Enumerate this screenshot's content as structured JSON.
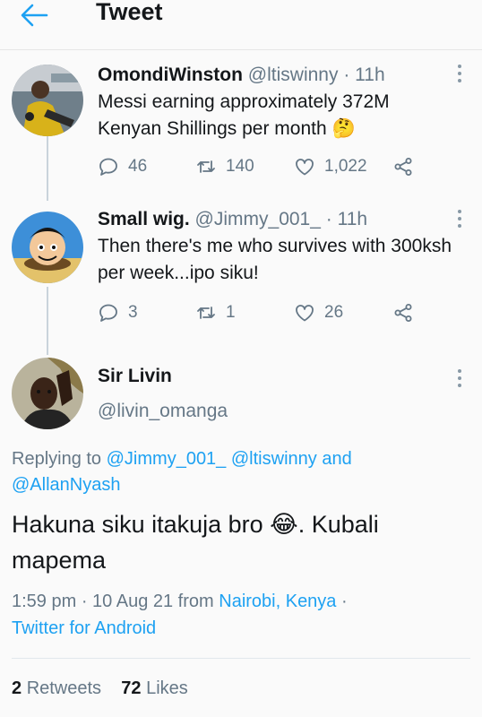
{
  "header": {
    "title": "Tweet",
    "back_icon": "arrow-left-icon"
  },
  "colors": {
    "accent": "#1da1f2",
    "muted": "#657786",
    "text": "#14171a"
  },
  "thread": [
    {
      "name": "OmondiWinston",
      "handle": "@ltiswinny",
      "time": "· 11h",
      "text": "Messi earning approximately 372M Kenyan Shillings per month",
      "emoji": "🤔",
      "replies": "46",
      "retweets": "140",
      "likes": "1,022"
    },
    {
      "name": "Small wig.",
      "handle": "@Jimmy_001_",
      "time": "· 11h",
      "text": "Then there's me who survives with 300ksh per week...ipo siku!",
      "replies": "3",
      "retweets": "1",
      "likes": "26"
    }
  ],
  "main": {
    "name": "Sir Livin",
    "handle": "@livin_omanga",
    "replying_prefix": "Replying to",
    "replying_handle_1": "@Jimmy_001_",
    "replying_handle_2": "@ltiswinny",
    "replying_and": "and",
    "replying_handle_3": "@AllanNyash",
    "text_before": "Hakuna siku itakuja bro",
    "emoji": "😂",
    "text_after": ". Kubali mapema",
    "time": "1:59 pm · 10 Aug 21 from",
    "location": "Nairobi, Kenya",
    "dot": "·",
    "client": "Twitter for Android",
    "retweet_count": "2",
    "retweet_label": "Retweets",
    "like_count": "72",
    "like_label": "Likes"
  }
}
